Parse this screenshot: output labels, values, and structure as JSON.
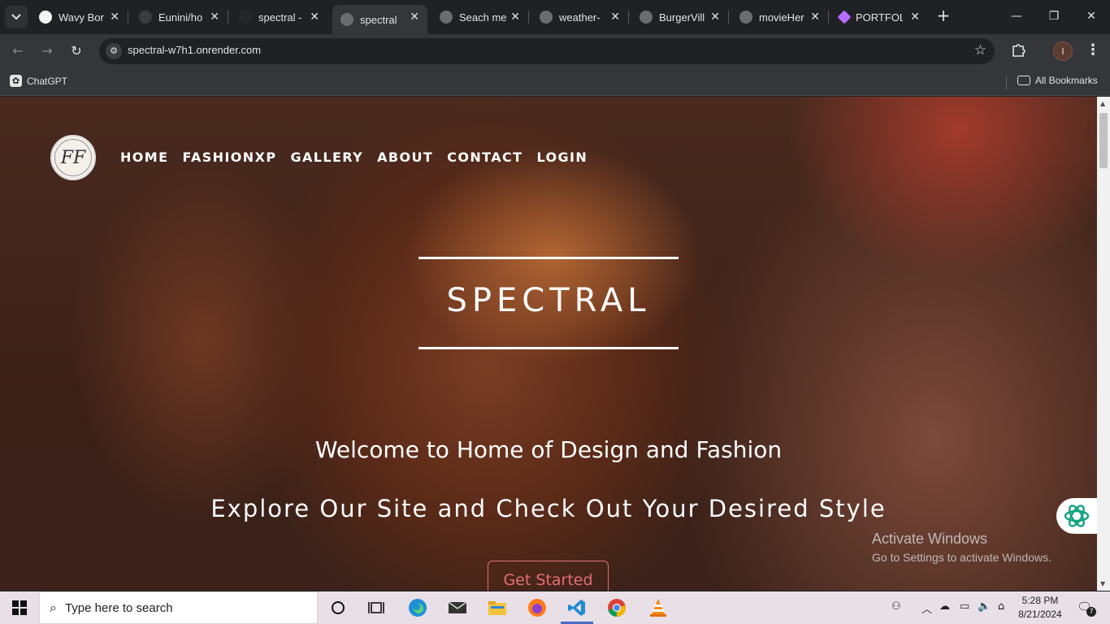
{
  "browser": {
    "tabs": [
      {
        "title": "Wavy Bor",
        "favicon_color": "#f5f5f5"
      },
      {
        "title": "Eunini/ho",
        "favicon_color": "#3b3c40"
      },
      {
        "title": "spectral -",
        "favicon_color": "#25262a"
      },
      {
        "title": "spectral",
        "favicon_color": "#6b6c70"
      },
      {
        "title": "Seach me",
        "favicon_color": "#6b6c70"
      },
      {
        "title": "weather-",
        "favicon_color": "#6b6c70"
      },
      {
        "title": "BurgerVill",
        "favicon_color": "#6b6c70"
      },
      {
        "title": "movieHer",
        "favicon_color": "#6b6c70"
      },
      {
        "title": "PORTFOL",
        "favicon_color": "#b56cff"
      }
    ],
    "active_tab_index": 3,
    "url": "spectral-w7h1.onrender.com",
    "profile_initial": "I",
    "bookmarks": [
      {
        "label": "ChatGPT"
      }
    ],
    "all_bookmarks_label": "All Bookmarks"
  },
  "page": {
    "nav": [
      "HOME",
      "FASHIONXP",
      "GALLERY",
      "ABOUT",
      "CONTACT",
      "LOGIN"
    ],
    "logo_monogram": "FF",
    "brand": "SPECTRAL",
    "welcome": "Welcome to Home of Design and Fashion",
    "explore": "Explore Our Site and Check Out Your Desired Style",
    "cta": "Get Started",
    "accent_color": "#e26d78"
  },
  "watermark": {
    "title": "Activate Windows",
    "subtitle": "Go to Settings to activate Windows."
  },
  "taskbar": {
    "search_placeholder": "Type here to search",
    "time": "5:28 PM",
    "date": "8/21/2024",
    "notification_count": "7",
    "pinned": [
      "cortana-icon",
      "task-view-icon",
      "edge-icon",
      "mail-icon",
      "file-explorer-icon",
      "firefox-icon",
      "vscode-icon",
      "chrome-icon",
      "vlc-icon"
    ]
  }
}
